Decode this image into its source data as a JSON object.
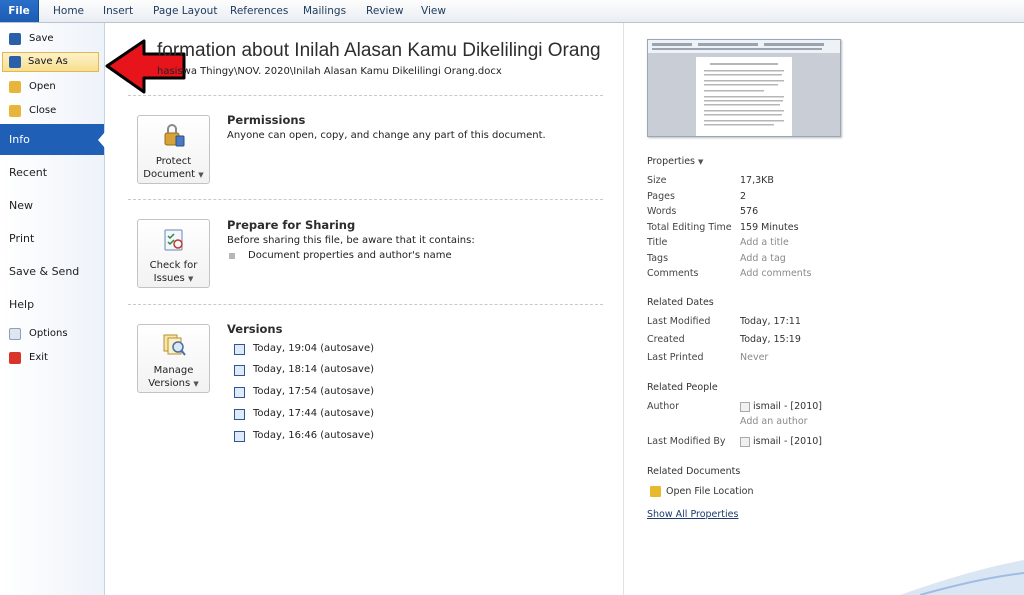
{
  "ribbon": {
    "tabs": [
      "File",
      "Home",
      "Insert",
      "Page Layout",
      "References",
      "Mailings",
      "Review",
      "View"
    ]
  },
  "nav": {
    "commands": {
      "save": "Save",
      "save_as": "Save As",
      "open": "Open",
      "close": "Close"
    },
    "tabs": {
      "info": "Info",
      "recent": "Recent",
      "new": "New",
      "print": "Print",
      "save_send": "Save & Send",
      "help": "Help"
    },
    "bottom": {
      "options": "Options",
      "exit": "Exit"
    }
  },
  "info": {
    "title": "formation about Inilah Alasan Kamu Dikelilingi Orang",
    "path": "hasiswa Thingy\\NOV. 2020\\Inilah Alasan Kamu Dikelilingi Orang.docx",
    "permissions": {
      "button": [
        "Protect",
        "Document"
      ],
      "heading": "Permissions",
      "text": "Anyone can open, copy, and change any part of this document."
    },
    "prepare": {
      "button": [
        "Check for",
        "Issues"
      ],
      "heading": "Prepare for Sharing",
      "text": "Before sharing this file, be aware that it contains:",
      "bullet": "Document properties and author's name"
    },
    "versions": {
      "button": [
        "Manage",
        "Versions"
      ],
      "heading": "Versions",
      "items": [
        "Today, 19:04 (autosave)",
        "Today, 18:14 (autosave)",
        "Today, 17:54 (autosave)",
        "Today, 17:44 (autosave)",
        "Today, 16:46 (autosave)"
      ]
    }
  },
  "properties": {
    "heading": "Properties",
    "items": [
      {
        "key": "Size",
        "value": "17,3KB",
        "muted": false
      },
      {
        "key": "Pages",
        "value": "2",
        "muted": false
      },
      {
        "key": "Words",
        "value": "576",
        "muted": false
      },
      {
        "key": "Total Editing Time",
        "value": "159 Minutes",
        "muted": false
      },
      {
        "key": "Title",
        "value": "Add a title",
        "muted": true
      },
      {
        "key": "Tags",
        "value": "Add a tag",
        "muted": true
      },
      {
        "key": "Comments",
        "value": "Add comments",
        "muted": true
      }
    ],
    "dates": {
      "heading": "Related Dates",
      "items": [
        {
          "key": "Last Modified",
          "value": "Today, 17:11",
          "muted": false
        },
        {
          "key": "Created",
          "value": "Today, 15:19",
          "muted": false
        },
        {
          "key": "Last Printed",
          "value": "Never",
          "muted": true
        }
      ]
    },
    "people": {
      "heading": "Related People",
      "author_label": "Author",
      "author": "ismail - [2010]",
      "add_author": "Add an author",
      "modified_label": "Last Modified By",
      "modified_by": "ismail - [2010]"
    },
    "documents": {
      "heading": "Related Documents",
      "open_location": "Open File Location",
      "show_all": "Show All Properties"
    }
  },
  "colors": {
    "file_tab": "#1b5cb4",
    "nav_selected": "#1f5fb6",
    "arrow": "#e8141b"
  }
}
